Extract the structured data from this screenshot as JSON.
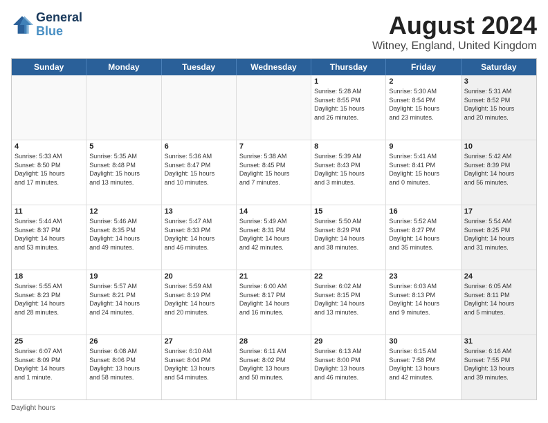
{
  "header": {
    "logo_line1": "General",
    "logo_line2": "Blue",
    "title": "August 2024",
    "subtitle": "Witney, England, United Kingdom"
  },
  "days": [
    "Sunday",
    "Monday",
    "Tuesday",
    "Wednesday",
    "Thursday",
    "Friday",
    "Saturday"
  ],
  "footer": {
    "daylight_label": "Daylight hours"
  },
  "weeks": [
    [
      {
        "day": "",
        "text": "",
        "empty": true
      },
      {
        "day": "",
        "text": "",
        "empty": true
      },
      {
        "day": "",
        "text": "",
        "empty": true
      },
      {
        "day": "",
        "text": "",
        "empty": true
      },
      {
        "day": "1",
        "text": "Sunrise: 5:28 AM\nSunset: 8:55 PM\nDaylight: 15 hours\nand 26 minutes."
      },
      {
        "day": "2",
        "text": "Sunrise: 5:30 AM\nSunset: 8:54 PM\nDaylight: 15 hours\nand 23 minutes."
      },
      {
        "day": "3",
        "text": "Sunrise: 5:31 AM\nSunset: 8:52 PM\nDaylight: 15 hours\nand 20 minutes.",
        "shaded": true
      }
    ],
    [
      {
        "day": "4",
        "text": "Sunrise: 5:33 AM\nSunset: 8:50 PM\nDaylight: 15 hours\nand 17 minutes."
      },
      {
        "day": "5",
        "text": "Sunrise: 5:35 AM\nSunset: 8:48 PM\nDaylight: 15 hours\nand 13 minutes."
      },
      {
        "day": "6",
        "text": "Sunrise: 5:36 AM\nSunset: 8:47 PM\nDaylight: 15 hours\nand 10 minutes."
      },
      {
        "day": "7",
        "text": "Sunrise: 5:38 AM\nSunset: 8:45 PM\nDaylight: 15 hours\nand 7 minutes."
      },
      {
        "day": "8",
        "text": "Sunrise: 5:39 AM\nSunset: 8:43 PM\nDaylight: 15 hours\nand 3 minutes."
      },
      {
        "day": "9",
        "text": "Sunrise: 5:41 AM\nSunset: 8:41 PM\nDaylight: 15 hours\nand 0 minutes."
      },
      {
        "day": "10",
        "text": "Sunrise: 5:42 AM\nSunset: 8:39 PM\nDaylight: 14 hours\nand 56 minutes.",
        "shaded": true
      }
    ],
    [
      {
        "day": "11",
        "text": "Sunrise: 5:44 AM\nSunset: 8:37 PM\nDaylight: 14 hours\nand 53 minutes."
      },
      {
        "day": "12",
        "text": "Sunrise: 5:46 AM\nSunset: 8:35 PM\nDaylight: 14 hours\nand 49 minutes."
      },
      {
        "day": "13",
        "text": "Sunrise: 5:47 AM\nSunset: 8:33 PM\nDaylight: 14 hours\nand 46 minutes."
      },
      {
        "day": "14",
        "text": "Sunrise: 5:49 AM\nSunset: 8:31 PM\nDaylight: 14 hours\nand 42 minutes."
      },
      {
        "day": "15",
        "text": "Sunrise: 5:50 AM\nSunset: 8:29 PM\nDaylight: 14 hours\nand 38 minutes."
      },
      {
        "day": "16",
        "text": "Sunrise: 5:52 AM\nSunset: 8:27 PM\nDaylight: 14 hours\nand 35 minutes."
      },
      {
        "day": "17",
        "text": "Sunrise: 5:54 AM\nSunset: 8:25 PM\nDaylight: 14 hours\nand 31 minutes.",
        "shaded": true
      }
    ],
    [
      {
        "day": "18",
        "text": "Sunrise: 5:55 AM\nSunset: 8:23 PM\nDaylight: 14 hours\nand 28 minutes."
      },
      {
        "day": "19",
        "text": "Sunrise: 5:57 AM\nSunset: 8:21 PM\nDaylight: 14 hours\nand 24 minutes."
      },
      {
        "day": "20",
        "text": "Sunrise: 5:59 AM\nSunset: 8:19 PM\nDaylight: 14 hours\nand 20 minutes."
      },
      {
        "day": "21",
        "text": "Sunrise: 6:00 AM\nSunset: 8:17 PM\nDaylight: 14 hours\nand 16 minutes."
      },
      {
        "day": "22",
        "text": "Sunrise: 6:02 AM\nSunset: 8:15 PM\nDaylight: 14 hours\nand 13 minutes."
      },
      {
        "day": "23",
        "text": "Sunrise: 6:03 AM\nSunset: 8:13 PM\nDaylight: 14 hours\nand 9 minutes."
      },
      {
        "day": "24",
        "text": "Sunrise: 6:05 AM\nSunset: 8:11 PM\nDaylight: 14 hours\nand 5 minutes.",
        "shaded": true
      }
    ],
    [
      {
        "day": "25",
        "text": "Sunrise: 6:07 AM\nSunset: 8:09 PM\nDaylight: 14 hours\nand 1 minute."
      },
      {
        "day": "26",
        "text": "Sunrise: 6:08 AM\nSunset: 8:06 PM\nDaylight: 13 hours\nand 58 minutes."
      },
      {
        "day": "27",
        "text": "Sunrise: 6:10 AM\nSunset: 8:04 PM\nDaylight: 13 hours\nand 54 minutes."
      },
      {
        "day": "28",
        "text": "Sunrise: 6:11 AM\nSunset: 8:02 PM\nDaylight: 13 hours\nand 50 minutes."
      },
      {
        "day": "29",
        "text": "Sunrise: 6:13 AM\nSunset: 8:00 PM\nDaylight: 13 hours\nand 46 minutes."
      },
      {
        "day": "30",
        "text": "Sunrise: 6:15 AM\nSunset: 7:58 PM\nDaylight: 13 hours\nand 42 minutes."
      },
      {
        "day": "31",
        "text": "Sunrise: 6:16 AM\nSunset: 7:55 PM\nDaylight: 13 hours\nand 39 minutes.",
        "shaded": true
      }
    ]
  ]
}
